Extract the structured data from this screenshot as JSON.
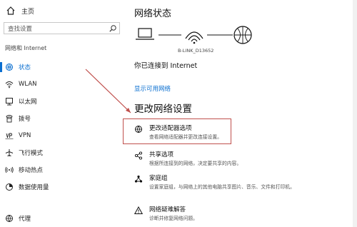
{
  "sidebar": {
    "home_label": "主页",
    "search_placeholder": "查找设置",
    "section_title": "网络和 Internet",
    "items": [
      {
        "label": "状态",
        "icon": "globe-icon",
        "selected": true
      },
      {
        "label": "WLAN",
        "icon": "wifi-icon"
      },
      {
        "label": "以太网",
        "icon": "ethernet-icon"
      },
      {
        "label": "拨号",
        "icon": "dialup-icon"
      },
      {
        "label": "VPN",
        "icon": "vpn-icon"
      },
      {
        "label": "飞行模式",
        "icon": "airplane-icon"
      },
      {
        "label": "移动热点",
        "icon": "hotspot-icon"
      },
      {
        "label": "数据使用量",
        "icon": "data-usage-icon"
      },
      {
        "label": "代理",
        "icon": "proxy-globe-icon"
      }
    ]
  },
  "main": {
    "title": "网络状态",
    "network_name": "B-LINK_D13652",
    "connected_text": "你已连接到 Internet",
    "available_link": "显示可用网络",
    "change_heading": "更改网络设置",
    "options": [
      {
        "title": "更改适配器选项",
        "desc": "查看网络适配器并更改连接设置。",
        "icon": "adapter-icon"
      },
      {
        "title": "共享选项",
        "desc": "根据所连接到的网络，决定要共享的内容。",
        "icon": "share-icon"
      },
      {
        "title": "家庭组",
        "desc": "设置家庭组，与网络上的其他电脑共享图片、音乐、文件和打印机。",
        "icon": "homegroup-icon"
      },
      {
        "title": "网络疑难解答",
        "desc": "诊断并修复网络问题。",
        "icon": "warning-icon"
      }
    ]
  },
  "colors": {
    "accent": "#0b6fd0",
    "annotation": "#c0504d"
  }
}
